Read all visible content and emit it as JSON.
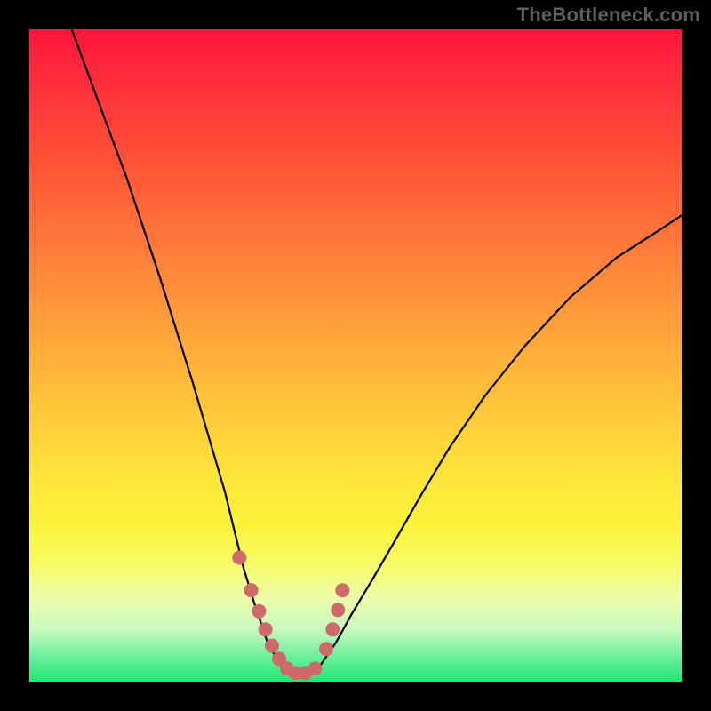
{
  "watermark": "TheBottleneck.com",
  "chart_data": {
    "type": "line",
    "title": "",
    "xlabel": "",
    "ylabel": "",
    "xlim": [
      0,
      1
    ],
    "ylim": [
      0,
      1
    ],
    "grid": false,
    "legend": false,
    "note": "Axes are unlabeled; values are normalized fractions of the plot area (0 = left/top edge of gradient, 1 = right/bottom for x, top for y).",
    "series": [
      {
        "name": "bottleneck-curve",
        "color": "#000000",
        "x": [
          0.065,
          0.1,
          0.15,
          0.2,
          0.25,
          0.3,
          0.328,
          0.345,
          0.365,
          0.385,
          0.405,
          0.425,
          0.446,
          0.47,
          0.495,
          0.525,
          0.56,
          0.6,
          0.645,
          0.7,
          0.76,
          0.83,
          0.9,
          0.97,
          1.0
        ],
        "y": [
          1.0,
          0.905,
          0.77,
          0.62,
          0.46,
          0.29,
          0.175,
          0.12,
          0.06,
          0.025,
          0.01,
          0.01,
          0.025,
          0.06,
          0.105,
          0.155,
          0.215,
          0.285,
          0.36,
          0.44,
          0.515,
          0.59,
          0.65,
          0.695,
          0.715
        ]
      },
      {
        "name": "marker-dots",
        "color": "#cf6a6a",
        "type": "scatter",
        "x": [
          0.322,
          0.34,
          0.352,
          0.362,
          0.372,
          0.383,
          0.395,
          0.408,
          0.423,
          0.438,
          0.455,
          0.465,
          0.473,
          0.48
        ],
        "y": [
          0.19,
          0.14,
          0.108,
          0.08,
          0.055,
          0.035,
          0.02,
          0.013,
          0.013,
          0.02,
          0.05,
          0.08,
          0.11,
          0.14
        ]
      }
    ]
  }
}
